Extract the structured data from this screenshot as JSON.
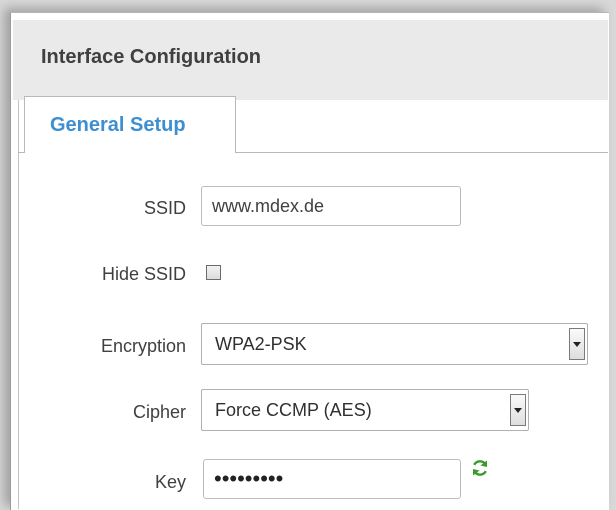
{
  "section": {
    "title": "Interface Configuration"
  },
  "tabs": [
    {
      "label": "General Setup",
      "active": true
    }
  ],
  "form": {
    "ssid": {
      "label": "SSID",
      "value": "www.mdex.de"
    },
    "hide_ssid": {
      "label": "Hide SSID",
      "checked": false
    },
    "encryption": {
      "label": "Encryption",
      "value": "WPA2-PSK"
    },
    "cipher": {
      "label": "Cipher",
      "value": "Force CCMP (AES)"
    },
    "key": {
      "label": "Key",
      "masked_value": "•••••••••"
    }
  },
  "icons": {
    "refresh": "refresh-icon"
  },
  "colors": {
    "tab_text": "#3d8fd1",
    "refresh": "#3a9a2c"
  }
}
